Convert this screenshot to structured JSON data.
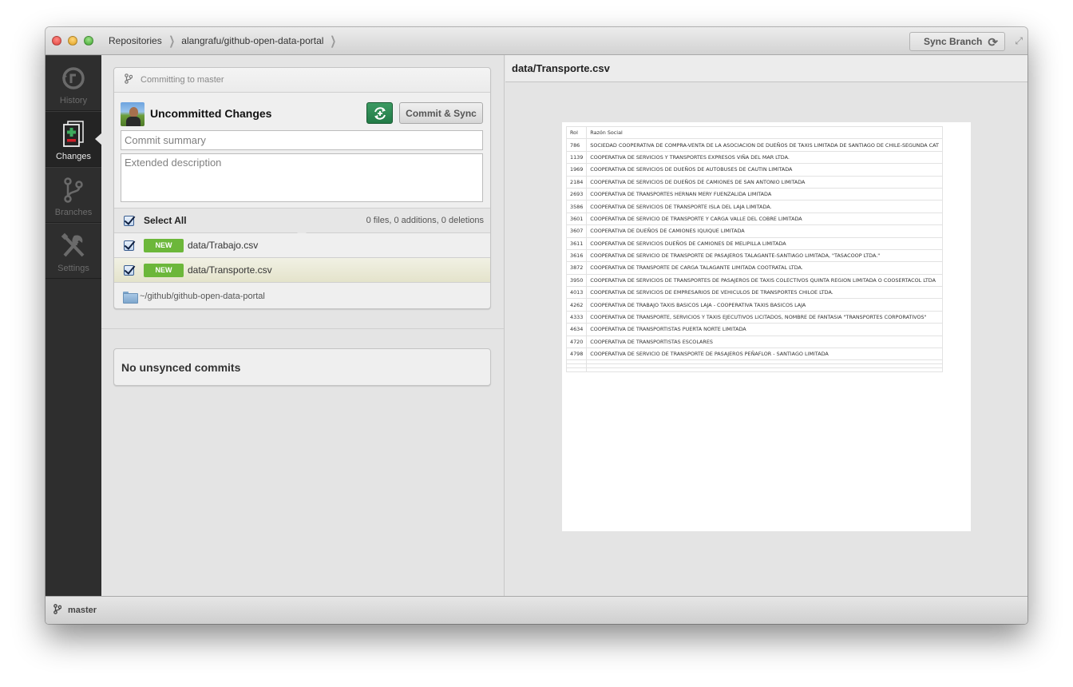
{
  "titlebar": {
    "breadcrumbs": [
      "Repositories",
      "alangrafu/github-open-data-portal"
    ],
    "sync_branch_label": "Sync Branch"
  },
  "sidebar": {
    "items": [
      {
        "label": "History",
        "icon": "history-icon",
        "active": false
      },
      {
        "label": "Changes",
        "icon": "changes-icon",
        "active": true
      },
      {
        "label": "Branches",
        "icon": "branch-icon",
        "active": false
      },
      {
        "label": "Settings",
        "icon": "settings-icon",
        "active": false
      }
    ]
  },
  "commit": {
    "committing_to": "Committing to master",
    "title": "Uncommitted Changes",
    "commit_sync_label": "Commit & Sync",
    "summary_placeholder": "Commit summary",
    "summary_value": "",
    "description_placeholder": "Extended description",
    "description_value": "",
    "select_all_label": "Select All",
    "select_all_checked": true,
    "stats": "0 files, 0 additions, 0 deletions",
    "files": [
      {
        "status": "NEW",
        "path": "data/Trabajo.csv",
        "checked": true,
        "selected": false
      },
      {
        "status": "NEW",
        "path": "data/Transporte.csv",
        "checked": true,
        "selected": true
      }
    ],
    "repo_path": "~/github/github-open-data-portal"
  },
  "unsynced": {
    "label": "No unsynced commits"
  },
  "preview": {
    "file_title": "data/Transporte.csv",
    "columns": [
      "Rol",
      "Razón Social"
    ],
    "rows": [
      [
        "786",
        "SOCIEDAD COOPERATIVA DE COMPRA-VENTA DE LA ASOCIACION DE DUEÑOS DE TAXIS LIMITADA DE SANTIAGO DE CHILE-SEGUNDA CAT"
      ],
      [
        "1139",
        "COOPERATIVA DE SERVICIOS Y TRANSPORTES EXPRESOS VIÑA DEL MAR LTDA."
      ],
      [
        "1969",
        "COOPERATIVA DE SERVICIOS DE DUEÑOS DE AUTOBUSES DE CAUTIN LIMITADA"
      ],
      [
        "2184",
        "COOPERATIVA DE SERVICIOS DE DUEÑOS DE CAMIONES DE SAN ANTONIO LIMITADA"
      ],
      [
        "2693",
        "COOPERATIVA DE TRANSPORTES HERNAN MERY FUENZALIDA LIMITADA"
      ],
      [
        "3586",
        "COOPERATIVA DE SERVICIOS DE TRANSPORTE ISLA DEL LAJA LIMITADA."
      ],
      [
        "3601",
        "COOPERATIVA DE SERVICIO DE TRANSPORTE Y CARGA VALLE DEL COBRE LIMITADA"
      ],
      [
        "3607",
        "COOPERATIVA DE DUEÑOS DE CAMIONES IQUIQUE LIMITADA"
      ],
      [
        "3611",
        "COOPERATIVA DE SERVICIOS DUEÑOS DE CAMIONES DE MELIPILLA LIMITADA"
      ],
      [
        "3616",
        "COOPERATIVA DE SERVICIO DE TRANSPORTE DE PASAJEROS TALAGANTE-SANTIAGO LIMITADA, \"TASACOOP LTDA.\""
      ],
      [
        "3872",
        "COOPERATIVA DE TRANSPORTE DE CARGA TALAGANTE LIMITADA COOTRATAL LTDA."
      ],
      [
        "3950",
        "COOPERATIVA DE SERVICIOS DE TRANSPORTES DE PASAJEROS DE TAXIS COLECTIVOS QUINTA REGION LIMITADA O COOSERTACOL LTDA"
      ],
      [
        "4013",
        "COOPERATIVA DE SERVICIOS DE EMPRESARIOS DE VEHICULOS DE TRANSPORTES CHILOE LTDA."
      ],
      [
        "4262",
        "COOPERATIVA DE TRABAJO TAXIS BASICOS LAJA - COOPERATIVA TAXIS BASICOS LAJA"
      ],
      [
        "4333",
        "COOPERATIVA DE TRANSPORTE, SERVICIOS Y TAXIS EJECUTIVOS LICITADOS, NOMBRE DE FANTASIA \"TRANSPORTES CORPORATIVOS\""
      ],
      [
        "4634",
        "COOPERATIVA DE TRANSPORTISTAS PUERTA NORTE LIMITADA"
      ],
      [
        "4720",
        "COOPERATIVA DE TRANSPORTISTAS ESCOLARES"
      ],
      [
        "4798",
        "COOPERATIVA DE SERVICIO DE TRANSPORTE DE PASAJEROS PEÑAFLOR - SANTIAGO LIMITADA"
      ]
    ],
    "empty_rows": 3
  },
  "statusbar": {
    "branch": "master"
  },
  "colors": {
    "accent_green": "#2e8b57",
    "new_badge": "#6cb73a",
    "sidebar_bg": "#2e2e2e"
  }
}
